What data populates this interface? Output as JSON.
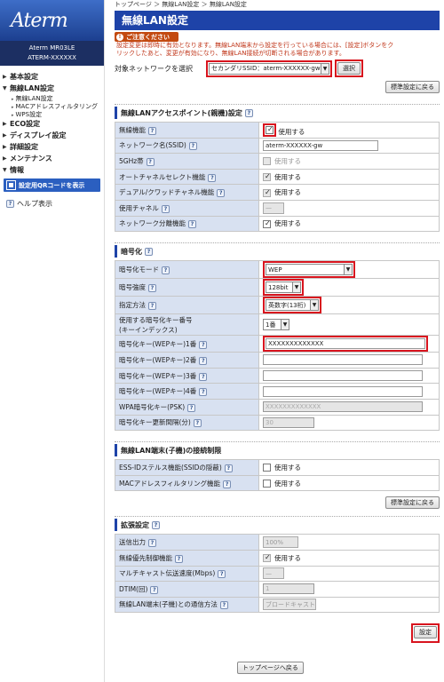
{
  "sidebar": {
    "logo": "Aterm",
    "model_line1": "Aterm MR03LE",
    "model_line2": "ATERM-XXXXXX",
    "nav": [
      {
        "label": "基本設定",
        "subs": []
      },
      {
        "label": "無線LAN設定",
        "subs": [
          "無線LAN設定",
          "MACアドレスフィルタリング",
          "WPS設定"
        ]
      },
      {
        "label": "ECO設定",
        "subs": []
      },
      {
        "label": "ディスプレイ設定",
        "subs": []
      },
      {
        "label": "詳細設定",
        "subs": []
      },
      {
        "label": "メンテナンス",
        "subs": []
      },
      {
        "label": "情報",
        "subs": []
      }
    ],
    "qr_button": "設定用QRコードを表示",
    "help": "ヘルプ表示"
  },
  "main": {
    "breadcrumb": "トップページ ＞ 無線LAN設定 ＞ 無線LAN設定",
    "title": "無線LAN設定",
    "notice_head": "ご注意ください",
    "notice_line1": "設定変更は即時に有効となります。無線LAN端末から設定を行っている場合には、[設定]ボタンをク",
    "notice_line2": "リックしたあと、変更が有効になり、無線LAN接続が切断される場合があります。",
    "target_label": "対象ネットワークを選択",
    "target_value": "セカンダリSSID：aterm-XXXXXX-gw",
    "select_button": "選択",
    "restore_button": "標準設定に戻る",
    "restore_button2": "標準設定に戻る",
    "use_label": "使用する",
    "sections": {
      "ap": {
        "title": "無線LANアクセスポイント(親機)設定"
      },
      "enc": {
        "title": "暗号化"
      },
      "lim": {
        "title": "無線LAN端末(子機)の接続制限"
      },
      "ext": {
        "title": "拡張設定"
      }
    },
    "ap_rows": {
      "wifi": "無線機能",
      "ssid": "ネットワーク名(SSID)",
      "ssid_value": "aterm-XXXXXX-gw",
      "band5": "5GHz帯",
      "auto_ch": "オートチャネルセレクト機能",
      "dual": "デュアル/クワッドチャネル機能",
      "channel": "使用チャネル",
      "channel_value": "—",
      "separation": "ネットワーク分離機能"
    },
    "enc_rows": {
      "mode": "暗号化モード",
      "mode_value": "WEP",
      "strength": "暗号強度",
      "strength_value": "128bit",
      "method": "指定方法",
      "method_value": "英数字(13桁)",
      "keyno1": "使用する暗号化キー番号",
      "keyno2": "(キーインデックス)",
      "keyno_value": "1番",
      "key1": "暗号化キー(WEPキー)1番",
      "key1_value": "XXXXXXXXXXXXX",
      "key2": "暗号化キー(WEPキー)2番",
      "key3": "暗号化キー(WEPキー)3番",
      "key4": "暗号化キー(WEPキー)4番",
      "wpa": "WPA暗号化キー(PSK)",
      "wpa_value": "XXXXXXXXXXXXX",
      "interval": "暗号化キー更新間隔(分)",
      "interval_value": "30"
    },
    "lim_rows": {
      "essid": "ESS-IDステルス機能(SSIDの隠蔽)",
      "mac": "MACアドレスフィルタリング機能"
    },
    "ext_rows": {
      "power": "送信出力",
      "power_value": "100%",
      "priority": "無線優先制御機能",
      "multicast": "マルチキャスト伝送速度(Mbps)",
      "multicast_value": "—",
      "dtim": "DTIM(回)",
      "dtim_value": "1",
      "comm": "無線LAN端末(子機)との通信方法",
      "comm_value": "ブロードキャスト"
    },
    "save_button": "設定",
    "back_button": "トップページへ戻る"
  }
}
